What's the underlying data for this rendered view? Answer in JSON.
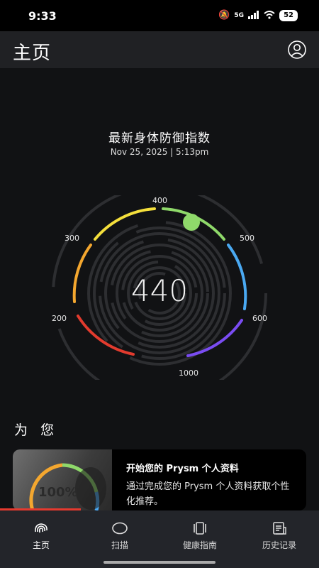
{
  "status": {
    "time": "9:33",
    "network": "5G",
    "battery": "52"
  },
  "appbar": {
    "title": "主页"
  },
  "section": {
    "title": "最新身体防御指数",
    "timestamp": "Nov 25, 2025 | 5:13pm"
  },
  "gauge": {
    "score": "440",
    "ticks": [
      "400",
      "500",
      "600",
      "1000",
      "200",
      "300"
    ]
  },
  "foryou": {
    "title": "为 您"
  },
  "card": {
    "thumb_percent": "100%",
    "title": "开始您的 Prysm 个人资料",
    "description": "通过完成您的 Prysm 个人资料获取个性化推荐。"
  },
  "nav": [
    {
      "label": "主页",
      "icon": "fingerprint-icon",
      "active": true
    },
    {
      "label": "扫描",
      "icon": "scan-oval-icon",
      "active": false
    },
    {
      "label": "健康指南",
      "icon": "cards-icon",
      "active": false
    },
    {
      "label": "历史记录",
      "icon": "history-icon",
      "active": false
    }
  ],
  "colors": {
    "accent_green": "#8fd96a",
    "active_progress": "#e53a2f"
  }
}
